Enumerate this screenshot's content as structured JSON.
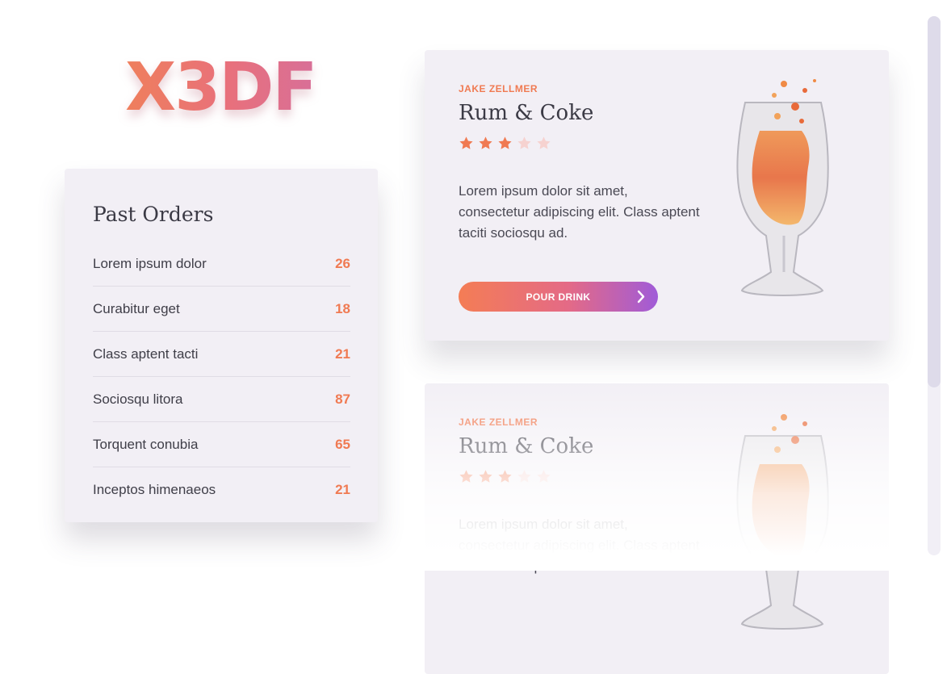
{
  "logo": {
    "text": "X3DF"
  },
  "past_orders": {
    "title": "Past Orders",
    "items": [
      {
        "name": "Lorem ipsum dolor",
        "count": "26"
      },
      {
        "name": "Curabitur eget",
        "count": "18"
      },
      {
        "name": "Class aptent tacti",
        "count": "21"
      },
      {
        "name": "Sociosqu litora",
        "count": "87"
      },
      {
        "name": "Torquent conubia",
        "count": "65"
      },
      {
        "name": "Inceptos himenaeos",
        "count": "21"
      }
    ]
  },
  "cards": [
    {
      "author": "JAKE ZELLMER",
      "drink": "Rum & Coke",
      "rating": 3,
      "max_rating": 5,
      "description": "Lorem ipsum dolor sit amet, consectetur adipiscing elit. Class aptent taciti sociosqu ad.",
      "button_label": "POUR DRINK"
    },
    {
      "author": "JAKE ZELLMER",
      "drink": "Rum & Coke",
      "rating": 3,
      "max_rating": 5,
      "description": "Lorem ipsum dolor sit amet, consectetur adipiscing elit. Class aptent taciti sociosqu ad."
    }
  ],
  "colors": {
    "accent": "#f07a52",
    "star_on": "#f07a52",
    "star_off": "#f6d2d0",
    "button_start": "#f47d55",
    "button_end": "#a05bd8",
    "panel": "#f2eff5"
  },
  "icons": {
    "star": "star-icon",
    "chevron": "chevron-right-icon",
    "glass": "cocktail-glass-icon"
  }
}
